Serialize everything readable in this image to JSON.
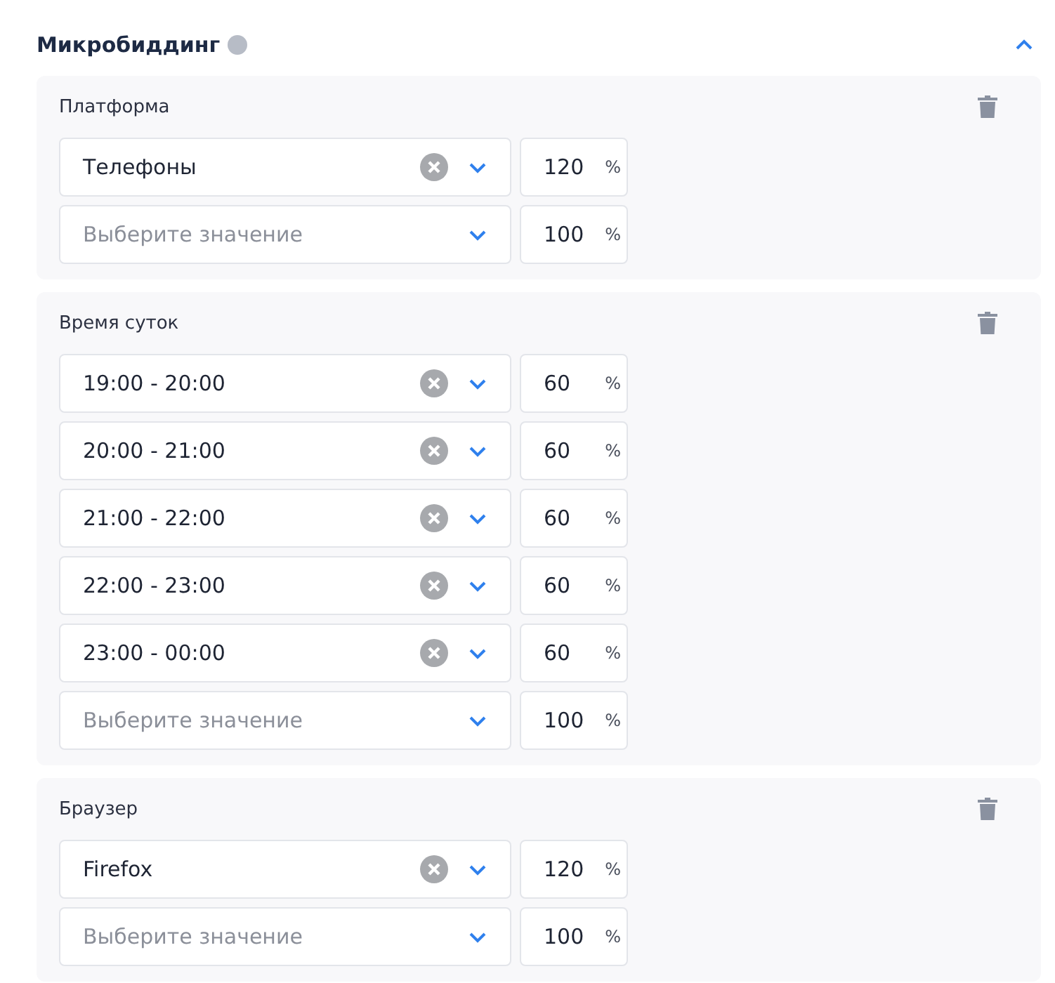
{
  "section": {
    "title": "Микробиддинг",
    "expanded": true
  },
  "groups": [
    {
      "label": "Платформа",
      "rows": [
        {
          "value": "Телефоны",
          "amount": "120",
          "unit": "%"
        },
        {
          "placeholder": "Выберите значение",
          "amount": "100",
          "unit": "%"
        }
      ]
    },
    {
      "label": "Время суток",
      "rows": [
        {
          "value": "19:00 - 20:00",
          "amount": "60",
          "unit": "%"
        },
        {
          "value": "20:00 - 21:00",
          "amount": "60",
          "unit": "%"
        },
        {
          "value": "21:00 - 22:00",
          "amount": "60",
          "unit": "%"
        },
        {
          "value": "22:00 - 23:00",
          "amount": "60",
          "unit": "%"
        },
        {
          "value": "23:00 - 00:00",
          "amount": "60",
          "unit": "%"
        },
        {
          "placeholder": "Выберите значение",
          "amount": "100",
          "unit": "%"
        }
      ]
    },
    {
      "label": "Браузер",
      "rows": [
        {
          "value": "Firefox",
          "amount": "120",
          "unit": "%"
        },
        {
          "placeholder": "Выберите значение",
          "amount": "100",
          "unit": "%"
        }
      ]
    }
  ]
}
